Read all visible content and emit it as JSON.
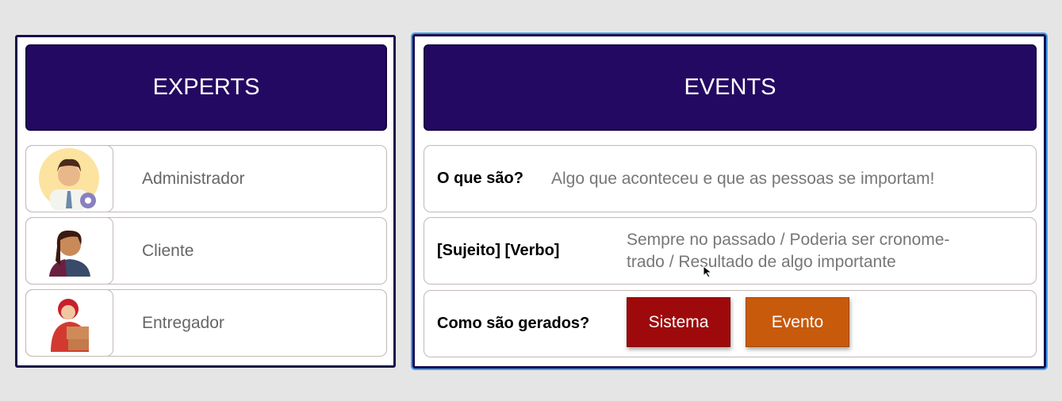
{
  "experts": {
    "title": "EXPERTS",
    "items": [
      {
        "label": "Administrador",
        "icon": "admin-avatar-icon"
      },
      {
        "label": "Cliente",
        "icon": "client-avatar-icon"
      },
      {
        "label": "Entregador",
        "icon": "delivery-avatar-icon"
      }
    ]
  },
  "events": {
    "title": "EVENTS",
    "rows": [
      {
        "question": "O que são?",
        "answer": "Algo que aconteceu e que as pessoas se importam!"
      },
      {
        "question": "[Sujeito] [Verbo]",
        "answer_line1": "Sempre no passado / Poderia ser cronome-",
        "answer_line2": "trado / Resultado de algo importante"
      },
      {
        "question": "Como são gerados?",
        "buttons": [
          {
            "label": "Sistema",
            "color": "#9e0a0c"
          },
          {
            "label": "Evento",
            "color": "#c85a0c"
          }
        ]
      }
    ]
  },
  "colors": {
    "header": "#240962",
    "selection": "#3aa0f0"
  }
}
